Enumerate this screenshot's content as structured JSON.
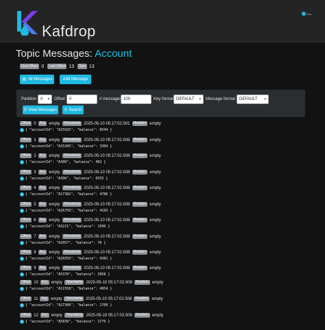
{
  "app": {
    "name": "Kafdrop",
    "github_label": "Star"
  },
  "page": {
    "title_prefix": "Topic Messages:",
    "topic": "Account"
  },
  "stats": [
    {
      "label": "First Offset",
      "value": "0"
    },
    {
      "label": "Last Offset",
      "value": "13"
    },
    {
      "label": "Size",
      "value": "13"
    }
  ],
  "buttons": {
    "all_messages": "All Messages",
    "add_message": "Add Message",
    "view_messages": "View Messages",
    "search": "Search"
  },
  "controls": {
    "partition_label": "Partition",
    "partition_value": "0",
    "offset_label": "Offset",
    "offset_value": "0",
    "messages_label": "# messages",
    "messages_value": "100",
    "key_format_label": "Key format",
    "key_format_value": "DEFAULT",
    "message_format_label": "Message format",
    "message_format_value": "DEFAULT"
  },
  "field_labels": {
    "offset": "Offset",
    "key": "Key",
    "timestamp": "Timestamp",
    "headers": "Headers"
  },
  "messages": [
    {
      "offset": "0",
      "key": "empty",
      "timestamp": "2025-05-10 05:17:02.501",
      "headers": "empty",
      "value": "{ \"accountId\": \"A25925\", \"balance\": 8544 }"
    },
    {
      "offset": "1",
      "key": "empty",
      "timestamp": "2025-05-10 05:17:02.508",
      "headers": "empty",
      "value": "{ \"accountId\": \"A15205\", \"balance\": 3304 }"
    },
    {
      "offset": "2",
      "key": "empty",
      "timestamp": "2025-05-10 05:17:02.508",
      "headers": "empty",
      "value": "{ \"accountId\": \"A300\", \"balance\": 402 }"
    },
    {
      "offset": "3",
      "key": "empty",
      "timestamp": "2025-05-10 05:17:02.508",
      "headers": "empty",
      "value": "{ \"accountId\": \"A300\", \"balance\": 6555 }"
    },
    {
      "offset": "4",
      "key": "empty",
      "timestamp": "2025-05-10 05:17:02.508",
      "headers": "empty",
      "value": "{ \"accountId\": \"A17382\", \"balance\": 4786 }"
    },
    {
      "offset": "5",
      "key": "empty",
      "timestamp": "2025-05-10 05:17:02.508",
      "headers": "empty",
      "value": "{ \"accountId\": \"A26759\", \"balance\": 4193 }"
    },
    {
      "offset": "6",
      "key": "empty",
      "timestamp": "2025-05-10 05:17:02.508",
      "headers": "empty",
      "value": "{ \"accountId\": \"A3221\", \"balance\": 1500 }"
    },
    {
      "offset": "7",
      "key": "empty",
      "timestamp": "2025-05-10 05:17:02.508",
      "headers": "empty",
      "value": "{ \"accountId\": \"A2057\", \"balance\": 76 }"
    },
    {
      "offset": "8",
      "key": "empty",
      "timestamp": "2025-05-10 05:17:02.508",
      "headers": "empty",
      "value": "{ \"accountId\": \"A20355\", \"balance\": 9381 }"
    },
    {
      "offset": "9",
      "key": "empty",
      "timestamp": "2025-05-10 05:17:02.508",
      "headers": "empty",
      "value": "{ \"accountId\": \"A5370\", \"balance\": 3958 }"
    },
    {
      "offset": "10",
      "key": "empty",
      "timestamp": "2025-05-10 05:17:02.508",
      "headers": "empty",
      "value": "{ \"accountId\": \"A11558\", \"balance\": 4954 }"
    },
    {
      "offset": "11",
      "key": "empty",
      "timestamp": "2025-05-10 05:17:02.508",
      "headers": "empty",
      "value": "{ \"accountId\": \"A27300\", \"balance\": 1709 }"
    },
    {
      "offset": "12",
      "key": "empty",
      "timestamp": "2025-05-10 05:17:02.508",
      "headers": "empty",
      "value": "{ \"accountId\": \"A5830\", \"balance\": 1779 }"
    }
  ],
  "colors": {
    "accent": "#1fb8e0",
    "background": "#121212",
    "header": "#242424",
    "badge": "#8a9096"
  }
}
